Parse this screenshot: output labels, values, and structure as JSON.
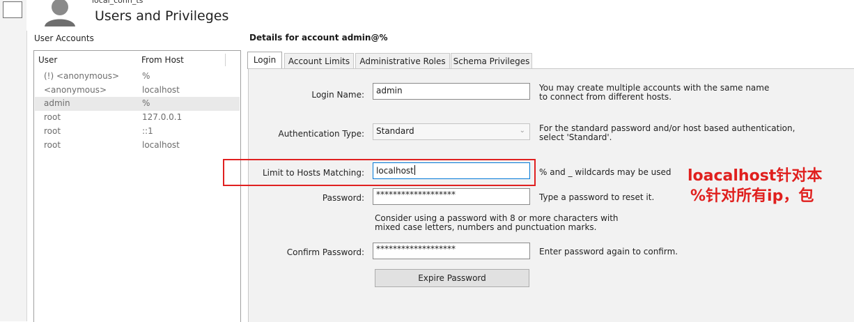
{
  "window": {
    "connection_name": "local_conn_ts",
    "page_title": "Users and Privileges"
  },
  "accounts": {
    "label": "User Accounts",
    "columns": {
      "user": "User",
      "host": "From Host"
    },
    "rows": [
      {
        "user": "(!) <anonymous>",
        "host": "%"
      },
      {
        "user": "<anonymous>",
        "host": "localhost"
      },
      {
        "user": "admin",
        "host": "%"
      },
      {
        "user": "root",
        "host": "127.0.0.1"
      },
      {
        "user": "root",
        "host": "::1"
      },
      {
        "user": "root",
        "host": "localhost"
      }
    ],
    "selected_index": 2
  },
  "details": {
    "title": "Details for account admin@%",
    "tabs": [
      "Login",
      "Account Limits",
      "Administrative Roles",
      "Schema Privileges"
    ],
    "active_tab": "Login",
    "login_name": {
      "label": "Login Name:",
      "value": "admin",
      "help": "You may create multiple accounts with the same name\nto connect from different hosts."
    },
    "auth_type": {
      "label": "Authentication Type:",
      "value": "Standard",
      "help": "For the standard password and/or host based authentication,\nselect 'Standard'."
    },
    "hosts": {
      "label": "Limit to Hosts Matching:",
      "value": "localhost",
      "help": "% and _ wildcards may be used"
    },
    "password": {
      "label": "Password:",
      "value": "*******************",
      "help": "Type a password to reset it."
    },
    "password_advice": "Consider using a password with 8 or more characters with\nmixed case letters, numbers and punctuation marks.",
    "confirm": {
      "label": "Confirm Password:",
      "value": "*******************",
      "help": "Enter password again to confirm."
    },
    "expire_button": "Expire Password"
  },
  "annotation": {
    "line1": "loacalhost针对本",
    "line2": "%针对所有ip，包",
    "color": "#e0201e"
  },
  "colors": {
    "panel_bg": "#f2f2f2",
    "selected_row": "#e9e9e9",
    "highlight_border": "#e02020"
  }
}
